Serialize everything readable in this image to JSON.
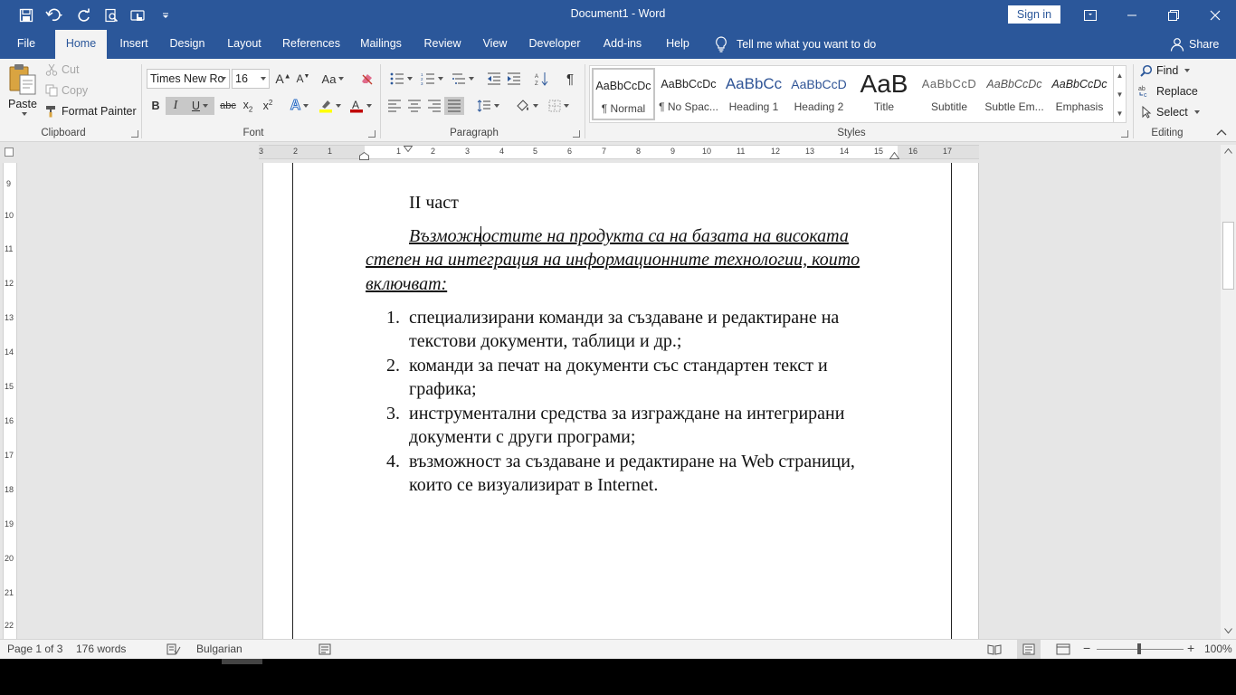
{
  "app": {
    "title": "Document1  -  Word",
    "signin": "Sign in"
  },
  "tabs": [
    "File",
    "Home",
    "Insert",
    "Design",
    "Layout",
    "References",
    "Mailings",
    "Review",
    "View",
    "Developer",
    "Add-ins",
    "Help"
  ],
  "tellme": "Tell me what you want to do",
  "share": "Share",
  "clipboard": {
    "paste": "Paste",
    "cut": "Cut",
    "copy": "Copy",
    "format_painter": "Format Painter",
    "label": "Clipboard"
  },
  "font": {
    "name": "Times New Ro",
    "size": "16",
    "label": "Font"
  },
  "paragraph": {
    "label": "Paragraph"
  },
  "styles": {
    "label": "Styles",
    "items": [
      {
        "sample": "AaBbCcDc",
        "name": "¶ Normal"
      },
      {
        "sample": "AaBbCcDc",
        "name": "¶ No Spac..."
      },
      {
        "sample": "AaBbCc",
        "name": "Heading 1"
      },
      {
        "sample": "AaBbCcD",
        "name": "Heading 2"
      },
      {
        "sample": "AaB",
        "name": "Title"
      },
      {
        "sample": "AaBbCcD",
        "name": "Subtitle"
      },
      {
        "sample": "AaBbCcDc",
        "name": "Subtle Em..."
      },
      {
        "sample": "AaBbCcDc",
        "name": "Emphasis"
      }
    ]
  },
  "editing": {
    "find": "Find",
    "replace": "Replace",
    "select": "Select",
    "label": "Editing"
  },
  "document": {
    "heading": "II част",
    "intro_lines": [
      "Възможностите на продукта са на базата на високата",
      "степен на интеграция на информационните технологии, които",
      "включват:"
    ],
    "list": [
      {
        "num": "1.",
        "lines": [
          "специализирани команди за създаване и редактиране на",
          "текстови документи, таблици и др.;"
        ]
      },
      {
        "num": "2.",
        "lines": [
          "команди за печат на документи със стандартен текст и",
          "графика;"
        ]
      },
      {
        "num": "3.",
        "lines": [
          "инструментални средства за изграждане на интегрирани",
          "документи с други програми;"
        ]
      },
      {
        "num": "4.",
        "lines": [
          "възможност за създаване и редактиране на Web страници,",
          "които се визуализират в Internet."
        ]
      }
    ]
  },
  "status": {
    "page": "Page 1 of 3",
    "words": "176 words",
    "language": "Bulgarian",
    "zoom": "100%"
  },
  "ruler": {
    "h_left": [
      "3",
      "2",
      "1"
    ],
    "h_right": [
      "1",
      "2",
      "3",
      "4",
      "5",
      "6",
      "7",
      "8",
      "9",
      "10",
      "11",
      "12",
      "13",
      "14",
      "15",
      "16",
      "17"
    ],
    "v": [
      "9",
      "10",
      "11",
      "12",
      "13",
      "14",
      "15",
      "16",
      "17",
      "18",
      "19",
      "20",
      "21",
      "22"
    ]
  },
  "colors": {
    "accent": "#2b579a",
    "highlight": "#ffff00",
    "font_color": "#c00000"
  }
}
